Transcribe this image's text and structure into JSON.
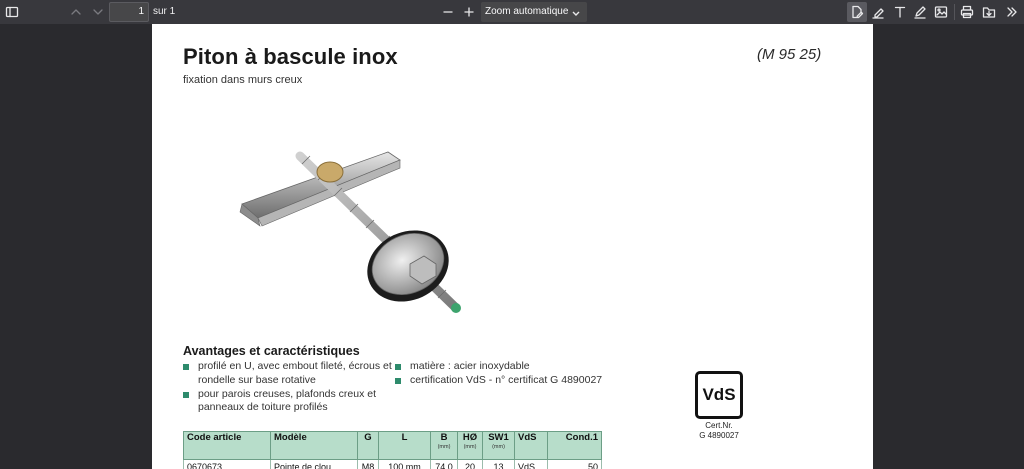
{
  "toolbar": {
    "page_number": "1",
    "page_count": "sur 1",
    "zoom": "Zoom automatique"
  },
  "document": {
    "title": "Piton à bascule inox",
    "subtitle": "fixation dans murs creux",
    "reference": "(M 95 25)",
    "advantages_title": "Avantages et caractéristiques",
    "bullets_left": [
      "profilé en U, avec embout fileté, écrous et rondelle sur base rotative",
      "pour parois creuses, plafonds creux et panneaux de toiture profilés"
    ],
    "bullets_right": [
      "matière : acier inoxydable",
      "certification VdS - n° certificat G 4890027"
    ],
    "vds_logo": "VdS",
    "vds_cert_line1": "Cert.Nr.",
    "vds_cert_line2": "G 4890027",
    "table": {
      "headers": [
        "Code article",
        "Modèle",
        "G",
        "L",
        "B",
        "HØ",
        "SW1",
        "VdS",
        "Cond.1"
      ],
      "units": [
        "",
        "",
        "",
        "",
        "(mm)",
        "(mm)",
        "(mm)",
        "",
        ""
      ],
      "rows": [
        [
          "0670673",
          "Pointe de clou",
          "M8",
          "100 mm",
          "74,0",
          "20",
          "13",
          "VdS",
          "50"
        ]
      ]
    }
  },
  "colors": {
    "toolbar_bg": "#38383d",
    "viewer_bg": "#2a2a2e",
    "accent_green": "#2e8b6c",
    "table_header_bg": "#b7ddca"
  }
}
